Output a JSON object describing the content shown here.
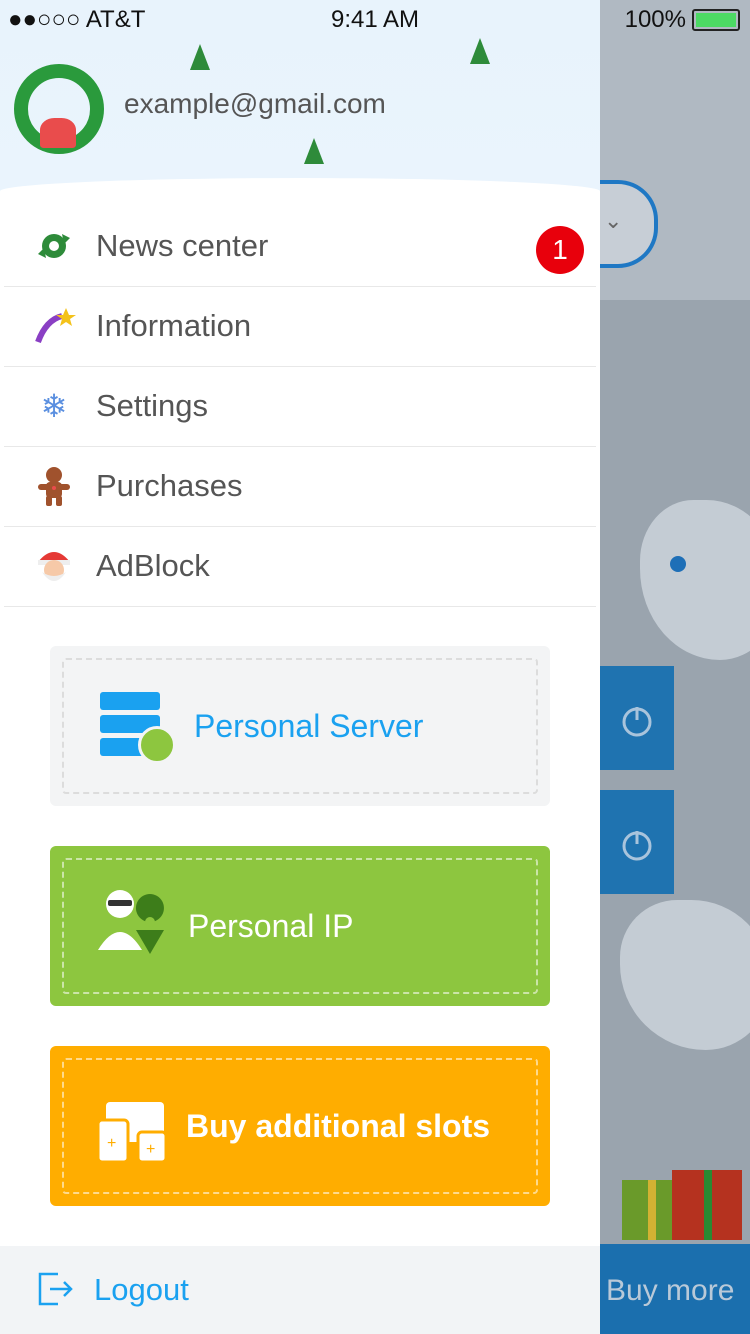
{
  "status_bar": {
    "carrier": "●●○○○ AT&T",
    "time": "9:41 AM",
    "battery": "100%"
  },
  "user": {
    "email": "example@gmail.com"
  },
  "menu": [
    {
      "label": "News center",
      "icon": "candy-icon",
      "badge": "1"
    },
    {
      "label": "Information",
      "icon": "shooting-star-icon"
    },
    {
      "label": "Settings",
      "icon": "snowflake-icon"
    },
    {
      "label": "Purchases",
      "icon": "gingerbread-icon"
    },
    {
      "label": "AdBlock",
      "icon": "santa-icon"
    }
  ],
  "cards": {
    "server": {
      "label": "Personal Server",
      "color": "#1aa1f0"
    },
    "ip": {
      "label": "Personal IP",
      "color": "#8dc63f"
    },
    "slots": {
      "label": "Buy additional slots",
      "color": "#ffad00"
    }
  },
  "logout": {
    "label": "Logout"
  },
  "background": {
    "buy_more": "Buy more"
  }
}
